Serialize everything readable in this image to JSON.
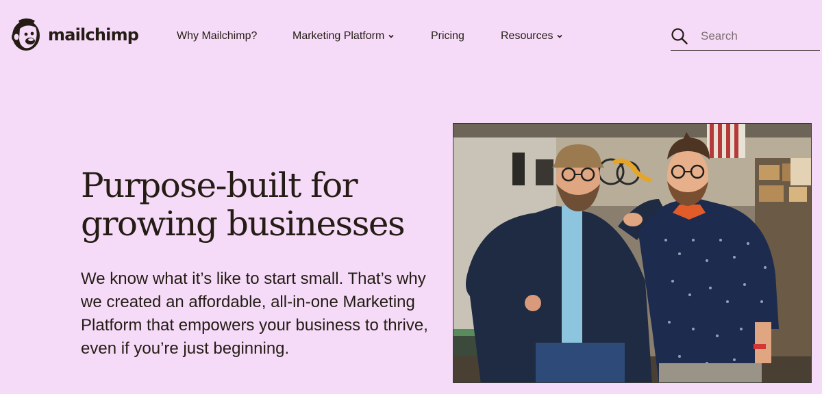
{
  "brand": {
    "name": "mailchimp",
    "logo_icon": "freddie-monkey-icon"
  },
  "nav": {
    "items": [
      {
        "label": "Why Mailchimp?",
        "has_dropdown": false
      },
      {
        "label": "Marketing Platform",
        "has_dropdown": true
      },
      {
        "label": "Pricing",
        "has_dropdown": false
      },
      {
        "label": "Resources",
        "has_dropdown": true
      }
    ]
  },
  "search": {
    "placeholder": "Search",
    "value": "",
    "icon": "search-icon"
  },
  "hero": {
    "title": "Purpose-built for growing businesses",
    "body": "We know what it’s like to start small. That’s why we created an affordable, all-in-one Marketing Platform that empowers your business to thrive, even if you’re just beginning.",
    "image_alt": "Two smiling men standing in a workshop"
  },
  "colors": {
    "background": "#f5dbf7",
    "text": "#241c15"
  }
}
